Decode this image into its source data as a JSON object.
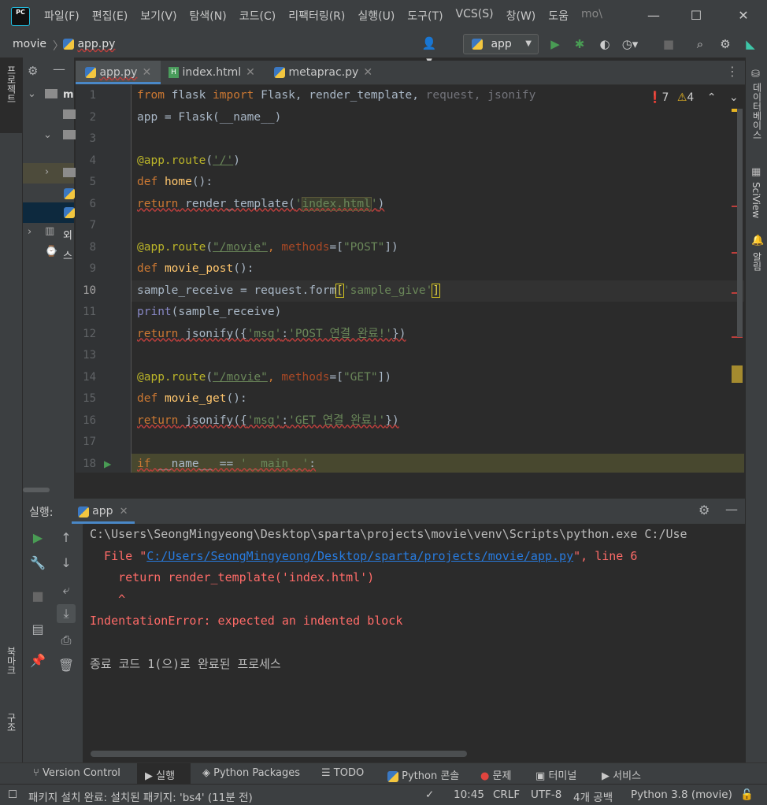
{
  "app": {
    "logo": "PC"
  },
  "menu": [
    "파일(F)",
    "편집(E)",
    "보기(V)",
    "탐색(N)",
    "코드(C)",
    "리팩터링(R)",
    "실행(U)",
    "도구(T)",
    "VCS(S)",
    "창(W)",
    "도움",
    "mo\\"
  ],
  "window": {
    "minimize": "—",
    "maximize": "☐",
    "close": "✕"
  },
  "nav": {
    "project": "movie",
    "file": "app.py",
    "run_config": "app"
  },
  "left_strip": {
    "project_label": "프로젝트",
    "bookmarks_label": "북마크",
    "structure_label": "구조"
  },
  "right_strip": {
    "database_label": "데이터베이스",
    "sciview_label": "SciView",
    "notifications_label": "알림"
  },
  "project_tree": {
    "row1": "m",
    "row_external": "외",
    "row_scratch": "스"
  },
  "editor_tabs": [
    {
      "label": "app.py",
      "icon": "python-icon"
    },
    {
      "label": "index.html",
      "icon": "html-icon"
    },
    {
      "label": "metaprac.py",
      "icon": "python-icon"
    }
  ],
  "inspection": {
    "errors": "7",
    "warnings": "4"
  },
  "code_lines": [
    {
      "n": "1"
    },
    {
      "n": "2"
    },
    {
      "n": "3"
    },
    {
      "n": "4"
    },
    {
      "n": "5"
    },
    {
      "n": "6"
    },
    {
      "n": "7"
    },
    {
      "n": "8"
    },
    {
      "n": "9"
    },
    {
      "n": "10"
    },
    {
      "n": "11"
    },
    {
      "n": "12"
    },
    {
      "n": "13"
    },
    {
      "n": "14"
    },
    {
      "n": "15"
    },
    {
      "n": "16"
    },
    {
      "n": "17"
    },
    {
      "n": "18"
    }
  ],
  "code": {
    "l1": [
      "from",
      " flask ",
      "import",
      " Flask, render_template, ",
      "request, jsonify"
    ],
    "l2": "app = Flask(__name__)",
    "l4": [
      "@app.route",
      "(",
      "'/'",
      ")"
    ],
    "l5": [
      "def",
      " ",
      "home",
      "():"
    ],
    "l6": [
      "return",
      " render_template(",
      "'",
      "index.html",
      "'",
      ")"
    ],
    "l8": [
      "@app.route",
      "(",
      "\"/movie\"",
      ", ",
      "methods",
      "=[",
      "\"POST\"",
      "])"
    ],
    "l9": [
      "def",
      " ",
      "movie_post",
      "():"
    ],
    "l10": [
      "sample_receive = request.form",
      "[",
      "'sample_give'",
      "]"
    ],
    "l11": [
      "print",
      "(sample_receive)"
    ],
    "l12": [
      "return",
      " jsonify({",
      "'msg'",
      ":",
      "'POST 연결 완료!'",
      "})"
    ],
    "l14": [
      "@app.route",
      "(",
      "\"/movie\"",
      ", ",
      "methods",
      "=[",
      "\"GET\"",
      "])"
    ],
    "l15": [
      "def",
      " ",
      "movie_get",
      "():"
    ],
    "l16": [
      "return",
      " jsonify({",
      "'msg'",
      ":",
      "'GET 연결 완료!'",
      "})"
    ],
    "l18": [
      "if",
      " __name__ == ",
      "'__main__'",
      ":"
    ]
  },
  "run_panel": {
    "label": "실행:",
    "tab": "app"
  },
  "console": {
    "l1": "C:\\Users\\SeongMingyeong\\Desktop\\sparta\\projects\\movie\\venv\\Scripts\\python.exe C:/Use",
    "l2_pre": "  File \"",
    "l2_link": "C:/Users/SeongMingyeong/Desktop/sparta/projects/movie/app.py",
    "l2_post": "\", line 6",
    "l3": "    return render_template('index.html')",
    "l4": "    ^",
    "l5": "IndentationError: expected an indented block",
    "l6": "종료 코드 1(으)로 완료된 프로세스"
  },
  "tool_windows": [
    "Version Control",
    "실행",
    "Python Packages",
    "TODO",
    "Python 콘솔",
    "문제",
    "터미널",
    "서비스"
  ],
  "status": {
    "message": "패키지 설치 완료: 설치된 패키지: 'bs4' (11분 전)",
    "time": "10:45",
    "line_sep": "CRLF",
    "encoding": "UTF-8",
    "indent": "4개 공백",
    "interpreter": "Python 3.8 (movie)"
  },
  "colors": {
    "error": "#bc3f3c",
    "warning": "#e6b422",
    "run_green": "#499c54",
    "link": "#287bde",
    "console_error": "#ff6b68"
  }
}
